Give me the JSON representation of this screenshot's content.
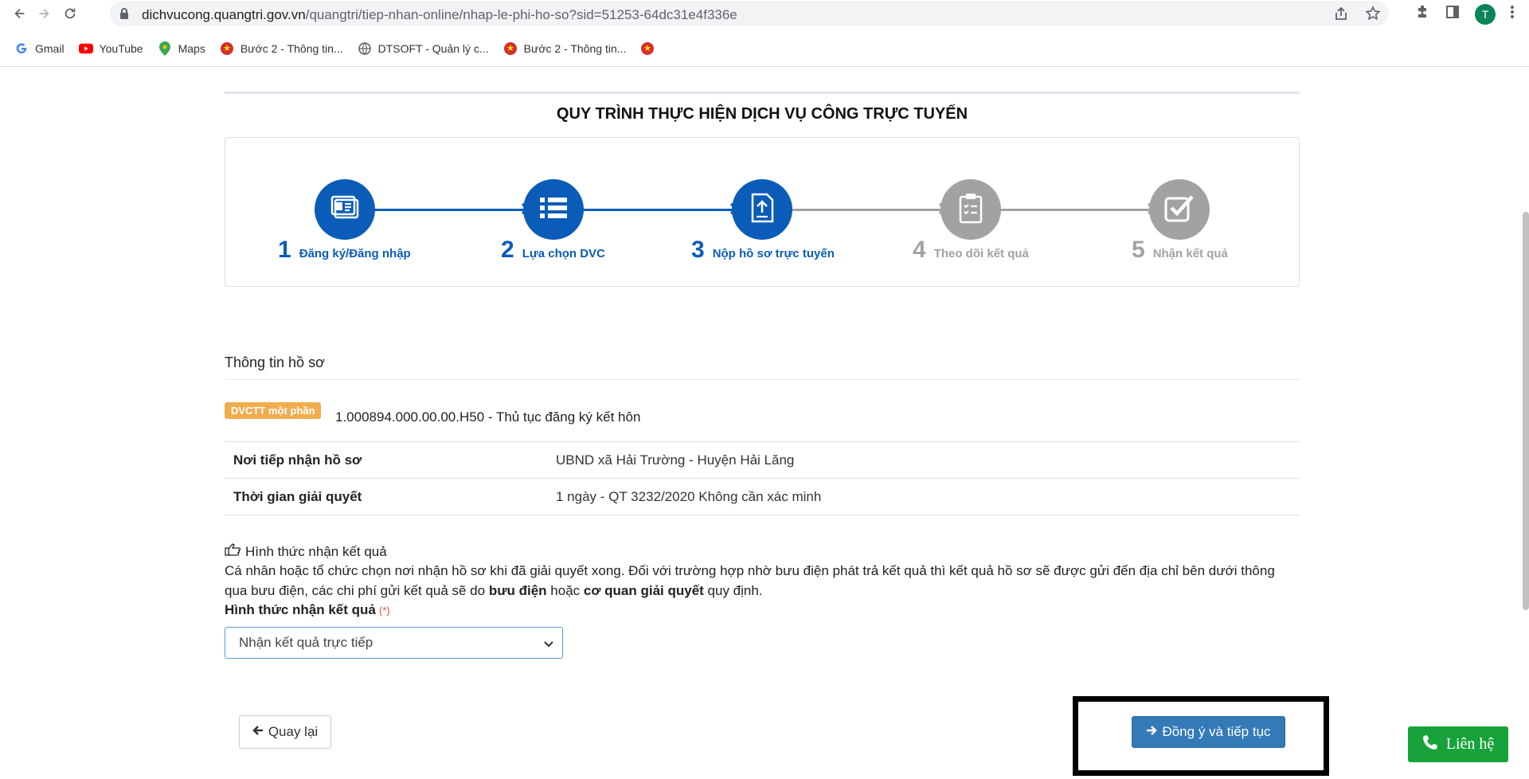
{
  "browser": {
    "url_host": "dichvucong.quangtri.gov.vn",
    "url_path": "/quangtri/tiep-nhan-online/nhap-le-phi-ho-so?sid=51253-64dc31e4f336e",
    "profile_initial": "T",
    "bookmarks": [
      {
        "label": "Gmail",
        "icon": "google-icon"
      },
      {
        "label": "YouTube",
        "icon": "youtube-icon"
      },
      {
        "label": "Maps",
        "icon": "maps-icon"
      },
      {
        "label": "Bước 2 - Thông tin...",
        "icon": "emblem-icon"
      },
      {
        "label": "DTSOFT - Quản lý c...",
        "icon": "globe-icon"
      },
      {
        "label": "Bước 2 - Thông tin...",
        "icon": "emblem-icon"
      },
      {
        "label": "",
        "icon": "emblem-icon"
      }
    ]
  },
  "process": {
    "title": "QUY TRÌNH THỰC HIỆN DỊCH VỤ CÔNG TRỰC TUYẾN",
    "steps": [
      {
        "num": "1",
        "label": "Đăng ký/Đăng nhập",
        "icon": "id-card-icon",
        "active": true
      },
      {
        "num": "2",
        "label": "Lựa chọn DVC",
        "icon": "list-icon",
        "active": true
      },
      {
        "num": "3",
        "label": "Nộp hồ sơ trực tuyến",
        "icon": "upload-document-icon",
        "active": true
      },
      {
        "num": "4",
        "label": "Theo dõi kết quả",
        "icon": "clipboard-checklist-icon",
        "active": false
      },
      {
        "num": "5",
        "label": "Nhận kết quả",
        "icon": "check-square-icon",
        "active": false
      }
    ],
    "colors": {
      "active": "#0a5cb8",
      "inactive": "#a2a2a2"
    }
  },
  "dossier": {
    "section_title": "Thông tin hồ sơ",
    "badge": "DVCTT một phần",
    "procedure": "1.000894.000.00.00.H50 - Thủ tục đăng ký kết hôn",
    "rows": [
      {
        "key": "Nơi tiếp nhận hồ sơ",
        "value": "UBND xã Hải Trường - Huyện Hải Lăng"
      },
      {
        "key": "Thời gian giải quyết",
        "value": "1 ngày - QT 3232/2020 Không cần xác minh"
      }
    ]
  },
  "receive_method": {
    "heading": "Hình thức nhận kết quả",
    "desc_part1": "Cá nhân hoặc tổ chức chọn nơi nhận hồ sơ khi đã giải quyết xong. Đối với trường hợp nhờ bưu điện phát trả kết quả thì kết quả hồ sơ sẽ được gửi đến địa chỉ bên dưới thông qua bưu điện, các chi phí gửi kết quả sẽ do ",
    "desc_bold1": "bưu điện",
    "desc_part2": " hoặc ",
    "desc_bold2": "cơ quan giải quyết",
    "desc_part3": " quy định.",
    "field_label": "Hình thức nhận kết quả",
    "required_mark": "(*)",
    "selected": "Nhận kết quả trực tiếp"
  },
  "actions": {
    "back_label": "Quay lại",
    "next_label": "Đồng ý và tiếp tục",
    "contact_label": "Liên hệ"
  }
}
